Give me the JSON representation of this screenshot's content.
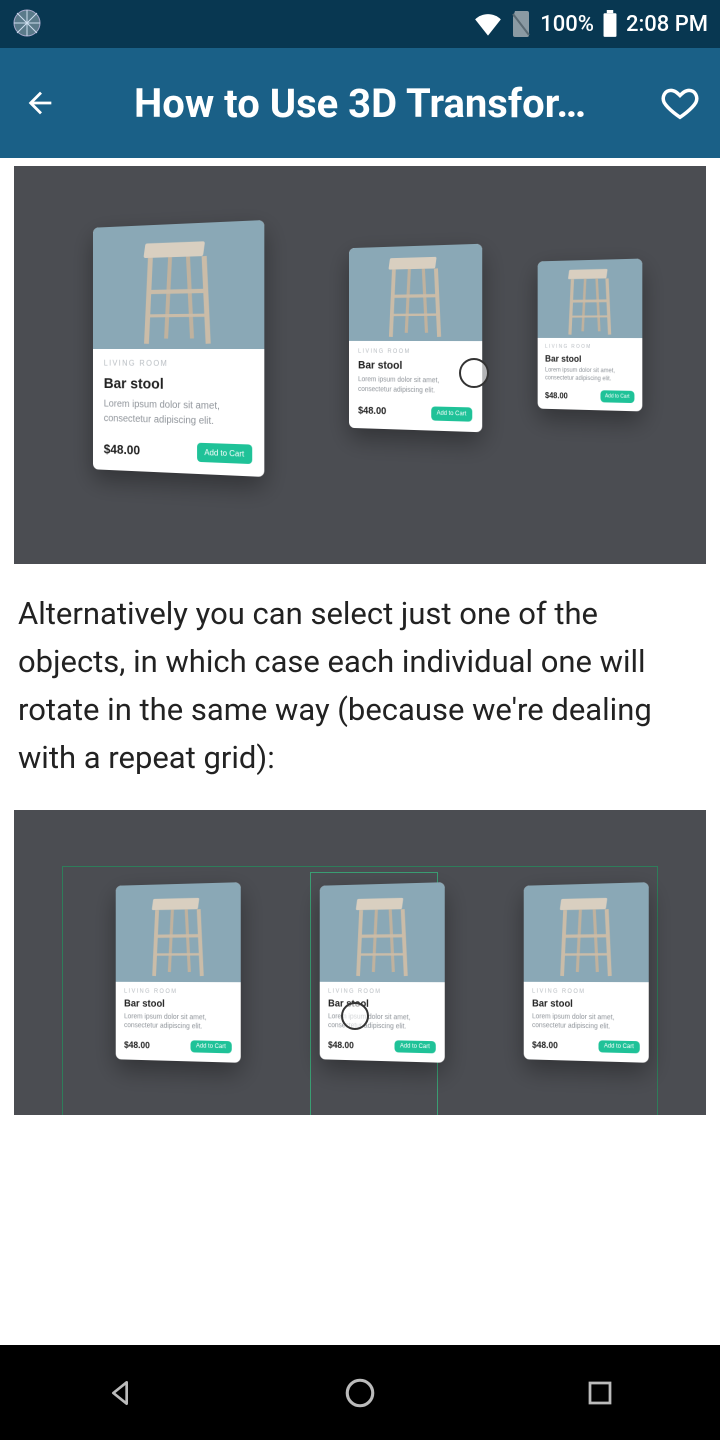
{
  "status": {
    "battery": "100%",
    "time": "2:08 PM"
  },
  "appbar": {
    "title": "How to Use 3D Transfor…"
  },
  "paragraph": "Alternatively you can select just one of the objects, in which case each individual one will rotate in the same way (because we're dealing with a repeat grid):",
  "card": {
    "category": "LIVING ROOM",
    "name": "Bar stool",
    "desc": "Lorem ipsum dolor sit amet, consectetur adipiscing elit.",
    "price": "$48.00",
    "button": "Add to Cart"
  }
}
